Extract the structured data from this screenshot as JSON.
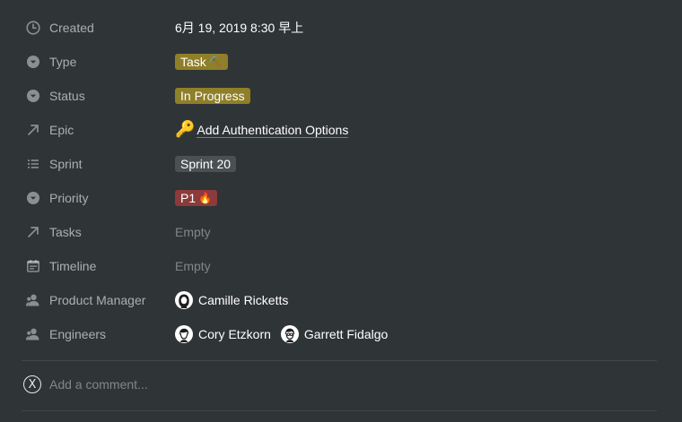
{
  "properties": {
    "created": {
      "label": "Created",
      "value": "6月 19, 2019 8:30 早上"
    },
    "type": {
      "label": "Type",
      "value": "Task",
      "emoji": "⛏️",
      "color": "#8f7f28"
    },
    "status": {
      "label": "Status",
      "value": "In Progress",
      "color": "#8f7f28"
    },
    "epic": {
      "label": "Epic",
      "icon_glyph": "🔑",
      "value": "Add Authentication Options"
    },
    "sprint": {
      "label": "Sprint",
      "value": "Sprint 20",
      "color": "#4b5053"
    },
    "priority": {
      "label": "Priority",
      "value": "P1",
      "emoji": "🔥",
      "color": "#8c3a3a"
    },
    "tasks": {
      "label": "Tasks",
      "value": "Empty"
    },
    "timeline": {
      "label": "Timeline",
      "value": "Empty"
    },
    "product_manager": {
      "label": "Product Manager",
      "people": [
        "Camille Ricketts"
      ]
    },
    "engineers": {
      "label": "Engineers",
      "people": [
        "Cory Etzkorn",
        "Garrett Fidalgo"
      ]
    }
  },
  "comment": {
    "avatar_letter": "X",
    "placeholder": "Add a comment..."
  },
  "icons": {
    "created": "clock-icon",
    "type": "select-icon",
    "status": "select-icon",
    "epic": "relation-arrow-icon",
    "sprint": "multi-select-list-icon",
    "priority": "select-icon",
    "tasks": "relation-arrow-icon",
    "timeline": "calendar-icon",
    "product_manager": "person-icon",
    "engineers": "person-icon"
  }
}
